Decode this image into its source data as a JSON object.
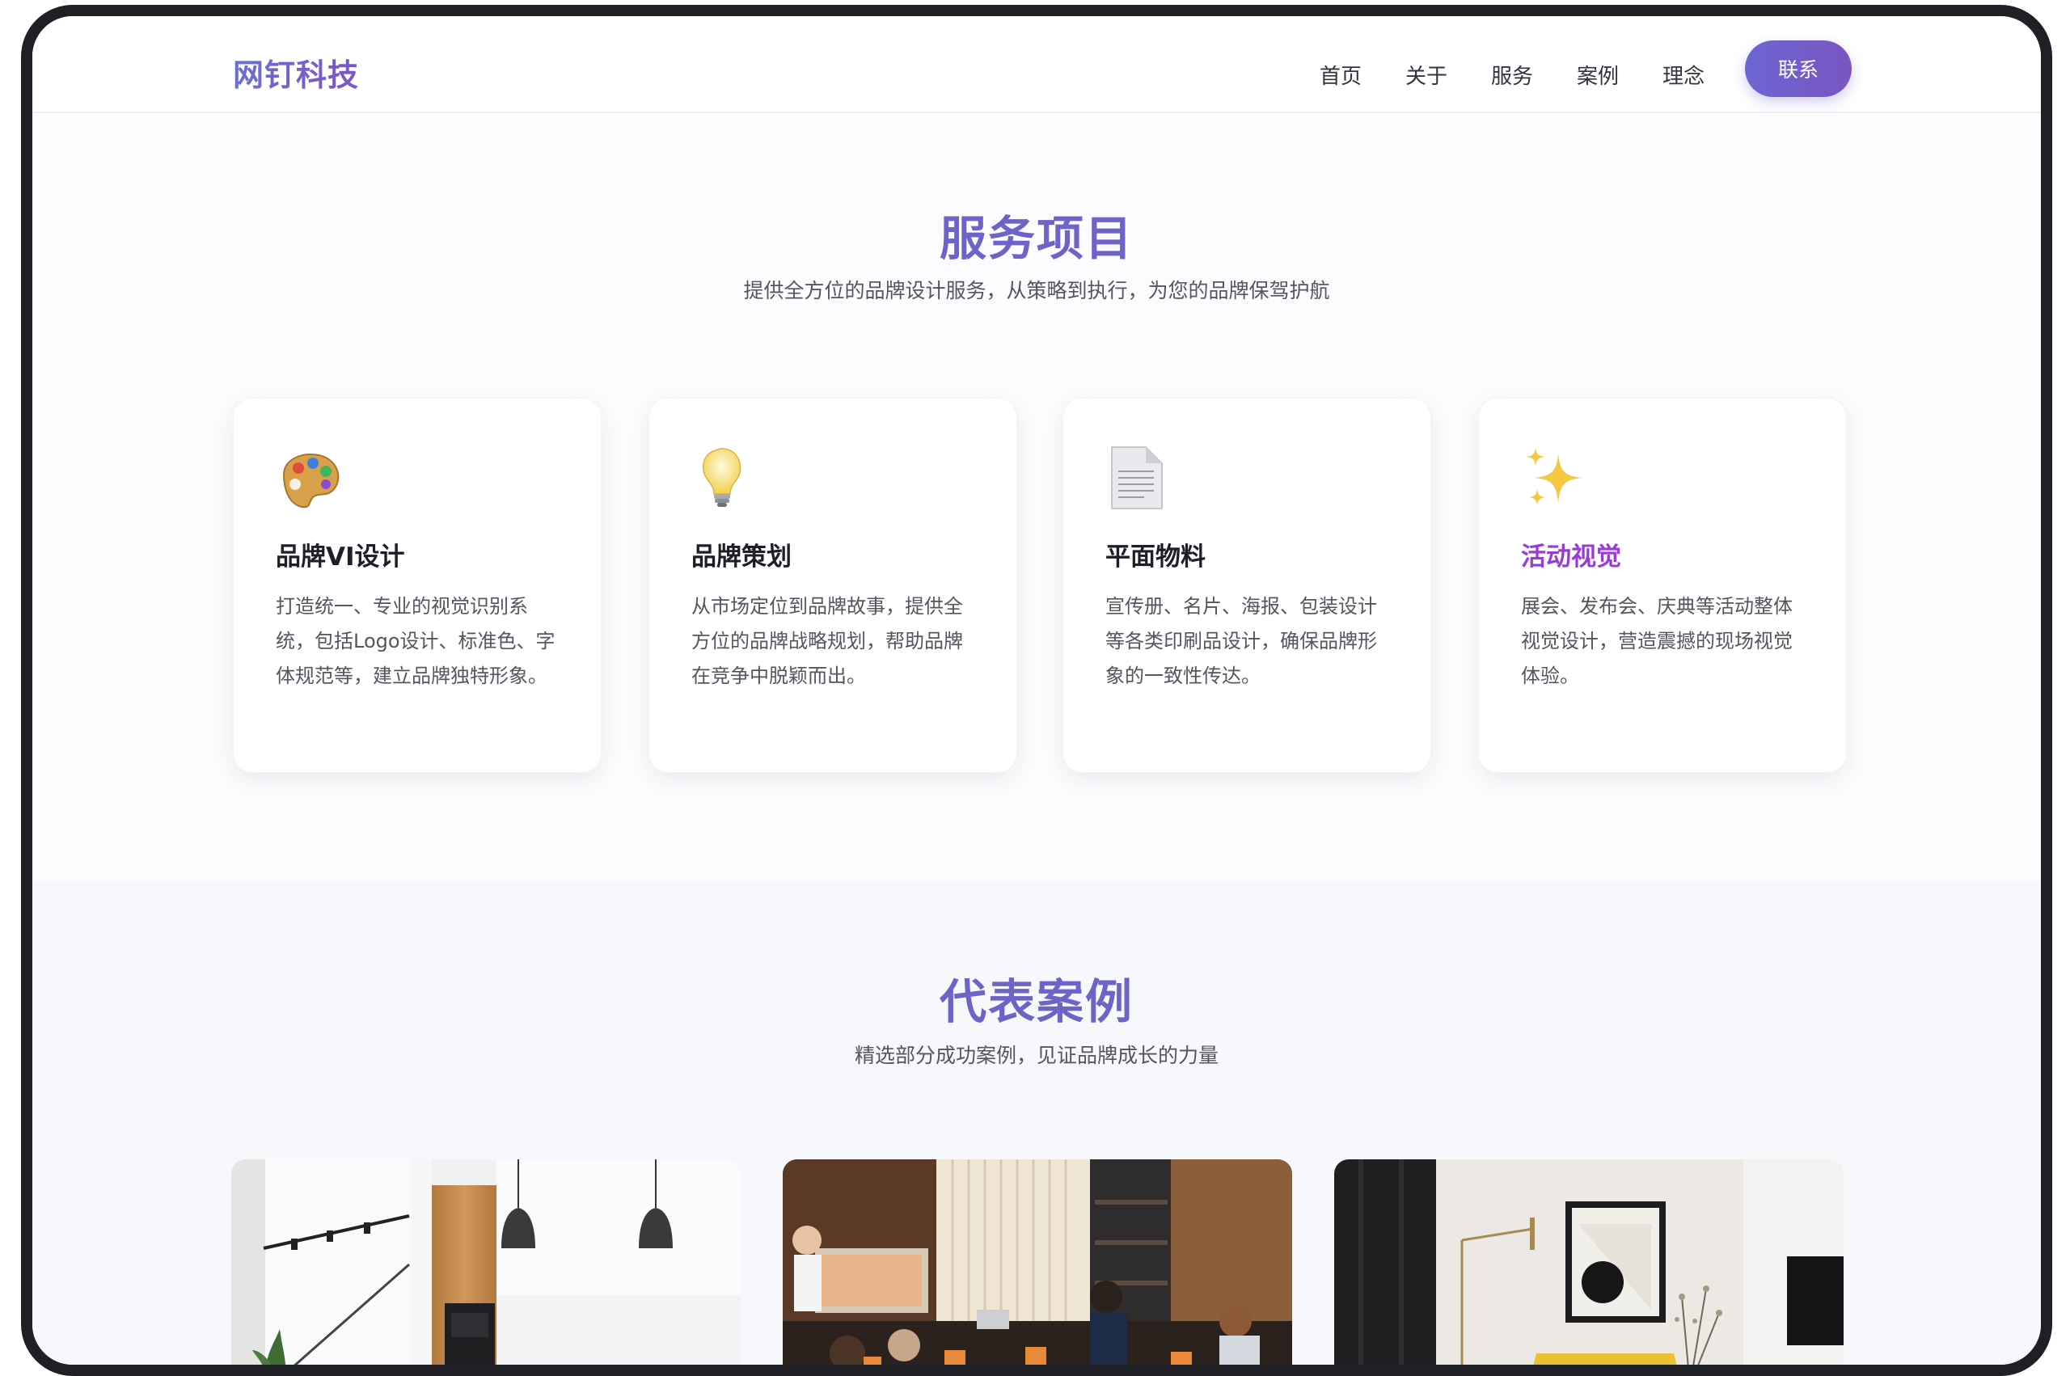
{
  "brand": {
    "name": "网钉科技"
  },
  "nav": {
    "items": [
      "首页",
      "关于",
      "服务",
      "案例",
      "理念"
    ],
    "cta": "联系"
  },
  "services": {
    "title": "服务项目",
    "subtitle": "提供全方位的品牌设计服务，从策略到执行，为您的品牌保驾护航",
    "cards": [
      {
        "icon": "palette-icon",
        "title": "品牌VI设计",
        "text": "打造统一、专业的视觉识别系统，包括Logo设计、标准色、字体规范等，建立品牌独特形象。"
      },
      {
        "icon": "lightbulb-icon",
        "title": "品牌策划",
        "text": "从市场定位到品牌故事，提供全方位的品牌战略规划，帮助品牌在竞争中脱颖而出。"
      },
      {
        "icon": "document-icon",
        "title": "平面物料",
        "text": "宣传册、名片、海报、包装设计等各类印刷品设计，确保品牌形象的一致性传达。"
      },
      {
        "icon": "sparkles-icon",
        "title": "活动视觉",
        "text": "展会、发布会、庆典等活动整体视觉设计，营造震撼的现场视觉体验。"
      }
    ]
  },
  "cases": {
    "title": "代表案例",
    "subtitle": "精选部分成功案例，见证品牌成长的力量",
    "images": [
      "kitchen-interior-photo",
      "meeting-room-photo",
      "living-room-interior-photo"
    ]
  },
  "colors": {
    "accent": "#6e63c6",
    "accent_purple": "#9a3bd6",
    "frame": "#1f2025"
  }
}
